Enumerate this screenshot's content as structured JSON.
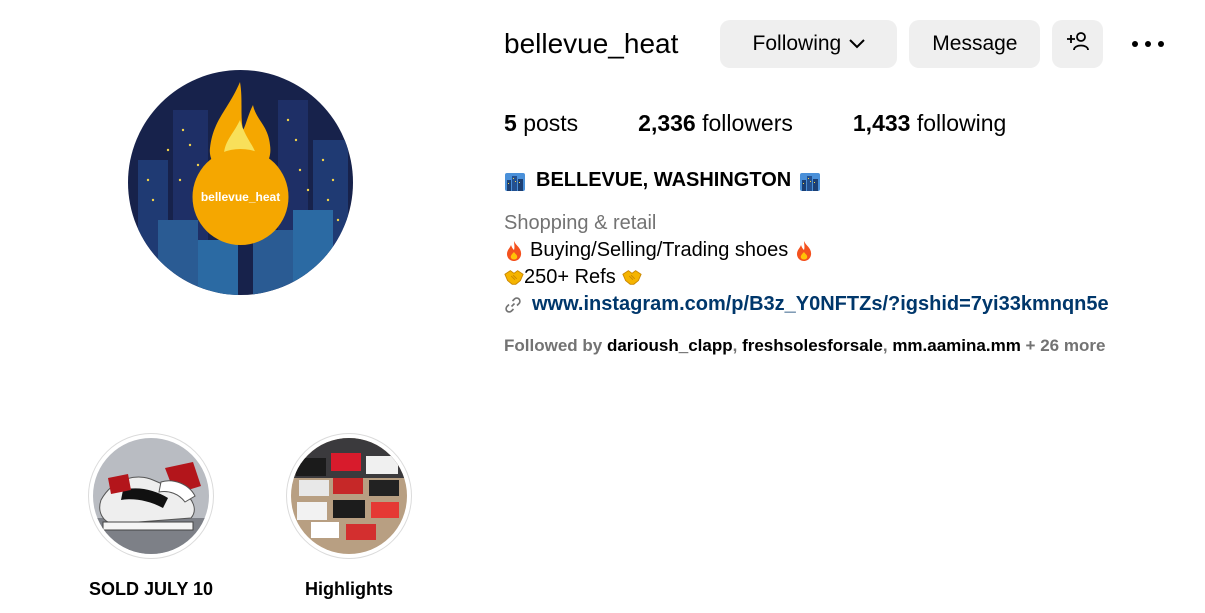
{
  "profile": {
    "username": "bellevue_heat",
    "avatar_text": "bellevue_heat",
    "buttons": {
      "following": "Following",
      "message": "Message"
    },
    "stats": [
      {
        "value": "5",
        "label": "posts"
      },
      {
        "value": "2,336",
        "label": "followers"
      },
      {
        "value": "1,433",
        "label": "following"
      }
    ],
    "bio": {
      "name": "BELLEVUE, WASHINGTON",
      "category": "Shopping & retail",
      "line1": "Buying/Selling/Trading shoes",
      "line2": "250+ Refs",
      "link": "www.instagram.com/p/B3z_Y0NFTZs/?igshid=7yi33kmnqn5e"
    },
    "followed_by": {
      "prefix": "Followed by",
      "users": [
        "darioush_clapp",
        "freshsolesforsale",
        "mm.aamina.mm"
      ],
      "more": "+ 26 more"
    }
  },
  "highlights": [
    {
      "label": "SOLD JULY 10"
    },
    {
      "label": "Highlights"
    }
  ],
  "icons": {
    "chevron": "chevron-down-icon",
    "add_user": "add-user-icon",
    "more": "more-options-icon",
    "link": "link-icon",
    "fire": "fire-icon",
    "city": "cityscape-icon",
    "handshake": "handshake-icon"
  },
  "colors": {
    "button_bg": "#efefef",
    "link": "#00376b",
    "secondary_text": "#737373",
    "avatar_bg": "#17224b",
    "avatar_circle": "#f5a700"
  }
}
